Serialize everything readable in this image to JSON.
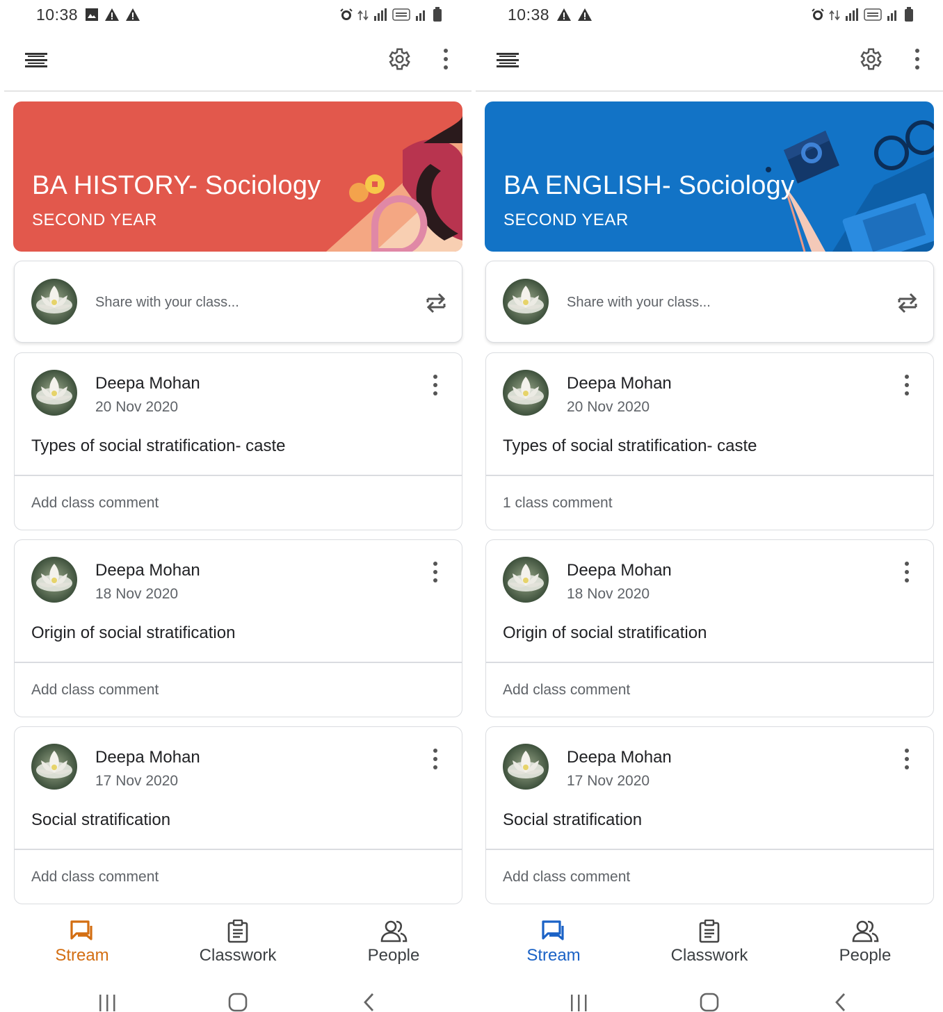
{
  "status_bar": {
    "time": "10:38"
  },
  "common": {
    "share_placeholder": "Share with your class...",
    "nav": {
      "stream": "Stream",
      "classwork": "Classwork",
      "people": "People"
    }
  },
  "screens": [
    {
      "banner": {
        "title": "BA HISTORY- Sociology",
        "subtitle": "SECOND YEAR",
        "color": "#e2584c"
      },
      "accent": "#d36e12",
      "posts": [
        {
          "author": "Deepa Mohan",
          "date": "20 Nov 2020",
          "title": "Types of social stratification- caste",
          "comment": "Add class comment"
        },
        {
          "author": "Deepa Mohan",
          "date": "18 Nov 2020",
          "title": "Origin of social stratification",
          "comment": "Add class comment"
        },
        {
          "author": "Deepa Mohan",
          "date": "17 Nov 2020",
          "title": "Social stratification",
          "comment": "Add class comment"
        }
      ]
    },
    {
      "banner": {
        "title": "BA ENGLISH- Sociology",
        "subtitle": "SECOND YEAR",
        "color": "#1273c6"
      },
      "accent": "#1a62c6",
      "posts": [
        {
          "author": "Deepa Mohan",
          "date": "20 Nov 2020",
          "title": "Types of social stratification- caste",
          "comment": "1 class comment"
        },
        {
          "author": "Deepa Mohan",
          "date": "18 Nov 2020",
          "title": "Origin of social stratification",
          "comment": "Add class comment"
        },
        {
          "author": "Deepa Mohan",
          "date": "17 Nov 2020",
          "title": "Social stratification",
          "comment": "Add class comment"
        }
      ]
    }
  ],
  "icons": [
    "menu-icon",
    "gear-icon",
    "more-vert-icon",
    "repost-icon",
    "stream-icon",
    "classwork-icon",
    "people-icon",
    "recents-icon",
    "home-icon",
    "back-icon"
  ]
}
